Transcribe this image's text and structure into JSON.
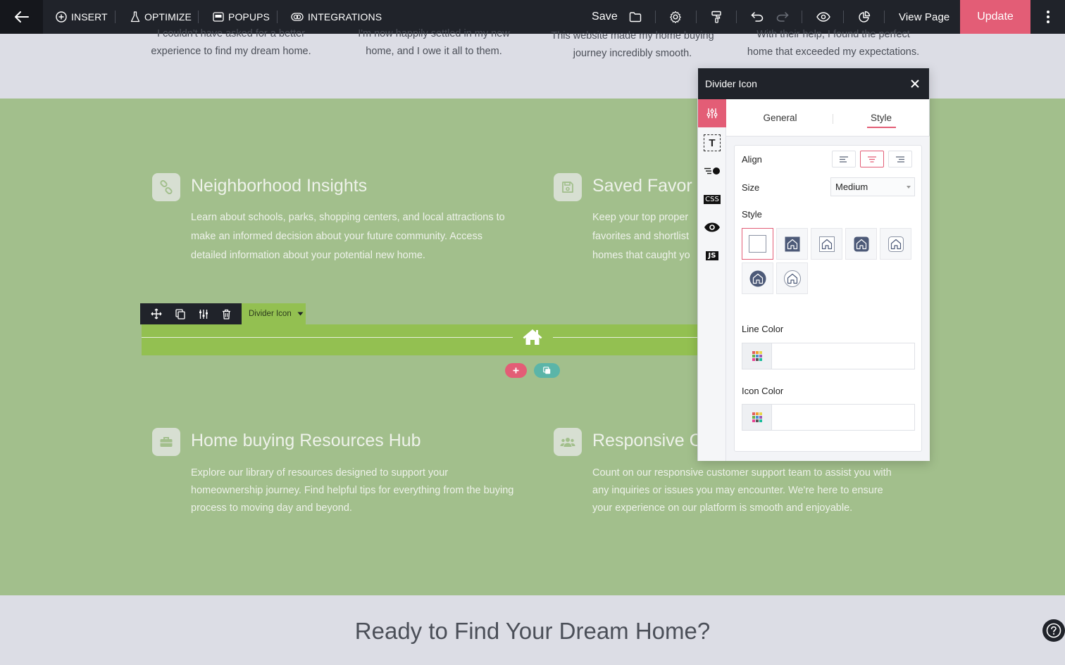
{
  "toolbar": {
    "insert_label": "INSERT",
    "optimize_label": "OPTIMIZE",
    "popups_label": "POPUPS",
    "integrations_label": "INTEGRATIONS",
    "save_label": "Save",
    "view_page_label": "View Page",
    "update_label": "Update"
  },
  "testimonials": [
    {
      "line1": "I couldn't have asked for a better",
      "line2": "experience to find my dream home."
    },
    {
      "line1": "I'm now happily settled in my new",
      "line2": "home, and I owe it all to them."
    },
    {
      "line1": "This website made my home buying",
      "line2": "journey incredibly smooth."
    },
    {
      "line1": "With their help, I found the perfect",
      "line2": "home that exceeded my expectations."
    }
  ],
  "features": [
    {
      "icon": "link-icon",
      "title": "Neighborhood Insights",
      "text": "Learn about schools, parks, shopping centers, and local attractions to make an informed decision about your future community. Access detailed information about your potential new home."
    },
    {
      "icon": "save-icon",
      "title": "Saved Favor",
      "text_lines": [
        "Keep your top proper",
        "favorites and shortlist",
        "homes that caught yo"
      ]
    },
    {
      "icon": "briefcase-icon",
      "title": "Home buying Resources Hub",
      "text": "Explore our library of resources designed to support your homeownership journey. Find helpful tips for everything from the buying process to moving day and beyond."
    },
    {
      "icon": "users-icon",
      "title": "Responsive C",
      "text": "Count on our responsive customer support team to assist you with any inquiries or issues you may encounter. We're here to ensure your experience on our platform is smooth and enjoyable."
    }
  ],
  "element_toolbar": {
    "label": "Divider Icon"
  },
  "cta": {
    "title": "Ready to Find Your Dream Home?"
  },
  "panel": {
    "title": "Divider Icon",
    "tabs": [
      "General",
      "Style"
    ],
    "active_tab": "Style",
    "rail": {
      "text_icon": "T",
      "css_label": "CSS",
      "js_label": "JS"
    },
    "align_label": "Align",
    "align_selected": "center",
    "size_label": "Size",
    "size_value": "Medium",
    "style_label": "Style",
    "line_color_label": "Line Color",
    "line_color_value": "",
    "icon_color_label": "Icon Color",
    "icon_color_value": ""
  },
  "colors": {
    "accent": "#e35d76",
    "toolbar_bg": "#20232a",
    "section_green": "#a2bf8c",
    "divider_green": "#93c051",
    "teal": "#5bb5a8"
  }
}
